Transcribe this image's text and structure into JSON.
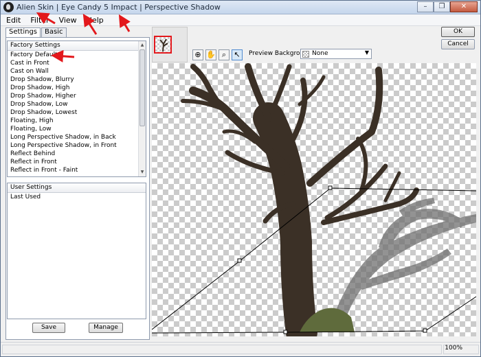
{
  "window": {
    "title": "Alien Skin | Eye Candy 5 Impact | Perspective Shadow",
    "minimize_glyph": "–",
    "restore_glyph": "❐",
    "close_glyph": "✕"
  },
  "menu": [
    "Edit",
    "Filter",
    "View",
    "Help"
  ],
  "tabs": {
    "settings": "Settings",
    "basic": "Basic"
  },
  "factory_settings": {
    "header": "Factory Settings",
    "items": [
      "Factory Default",
      "Cast in Front",
      "Cast on Wall",
      "Drop Shadow, Blurry",
      "Drop Shadow, High",
      "Drop Shadow, Higher",
      "Drop Shadow, Low",
      "Drop Shadow, Lowest",
      "Floating, High",
      "Floating, Low",
      "Long Perspective Shadow, in Back",
      "Long Perspective Shadow, in Front",
      "Reflect Behind",
      "Reflect in Front",
      "Reflect in Front - Faint"
    ]
  },
  "user_settings": {
    "header": "User Settings",
    "items": [
      "Last Used"
    ]
  },
  "buttons": {
    "save": "Save",
    "manage": "Manage",
    "ok": "OK",
    "cancel": "Cancel"
  },
  "preview": {
    "background_label": "Preview Background:",
    "background_value": "None"
  },
  "status": {
    "zoom": "100%"
  },
  "icons": [
    "alien-skin-app-icon",
    "pan-hand-icon",
    "zoom-icon",
    "pointer-icon",
    "navigate-icon"
  ],
  "colors": {
    "annotation_red": "#e3181c",
    "selection": "#cfe3f7"
  }
}
